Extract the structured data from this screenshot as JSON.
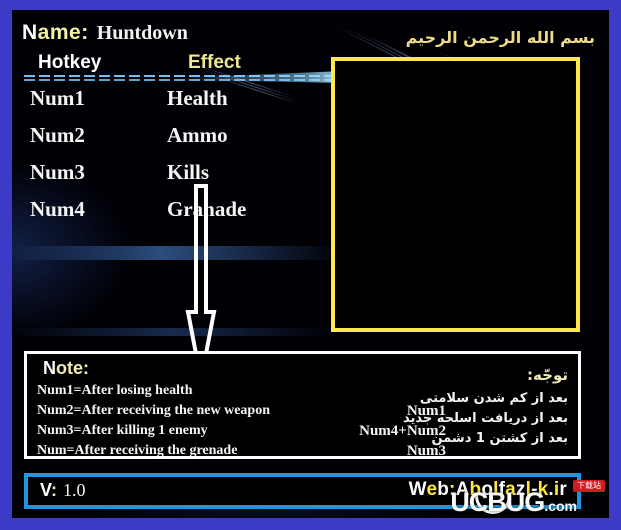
{
  "window": {
    "border_color": "#3b3bc8",
    "panel_bg": "#000005"
  },
  "header": {
    "name_label_first": "N",
    "name_label_rest": "ame:",
    "name_value": "Huntdown",
    "bismillah": "بسم الله الرحمن الرحيم",
    "columns": {
      "hotkey": "Hotkey",
      "effect": "Effect"
    }
  },
  "hotkeys": [
    {
      "key": "Num1",
      "effect": "Health"
    },
    {
      "key": "Num2",
      "effect": "Ammo"
    },
    {
      "key": "Num3",
      "effect": "Kills"
    },
    {
      "key": "Num4",
      "effect": "Granade"
    }
  ],
  "preview": {
    "border_color": "#ffe94a"
  },
  "note": {
    "title_first": "N",
    "title_rest": "ote:",
    "title_fa": "توجّه:",
    "lines_en": [
      "Num1=After losing health",
      "Num2=After receiving the new weapon",
      "Num3=After killing 1 enemy",
      "Num=After receiving the grenade"
    ],
    "lines_keys": [
      "Num1",
      "Num4+Num2",
      "Num3"
    ],
    "lines_fa": [
      "بعد از كم شدن سلامتى",
      "بعد از دريافت اسلحه جديد",
      "بعد از كشتن 1 دشمن"
    ]
  },
  "footer": {
    "version_label_first": "V",
    "version_label_rest": ":",
    "version_value": "1.0",
    "web_chars": [
      {
        "t": "W",
        "c": "w"
      },
      {
        "t": "e",
        "c": "y"
      },
      {
        "t": "b",
        "c": "w"
      },
      {
        "t": ":",
        "c": "y"
      },
      {
        "t": "A",
        "c": "w"
      },
      {
        "t": "b",
        "c": "y"
      },
      {
        "t": "o",
        "c": "w"
      },
      {
        "t": "l",
        "c": "y"
      },
      {
        "t": "f",
        "c": "w"
      },
      {
        "t": "a",
        "c": "y"
      },
      {
        "t": "z",
        "c": "w"
      },
      {
        "t": "l",
        "c": "y"
      },
      {
        "t": "-",
        "c": "w"
      },
      {
        "t": "k",
        "c": "y"
      },
      {
        "t": ".",
        "c": "w"
      },
      {
        "t": "i",
        "c": "y"
      },
      {
        "t": "r",
        "c": "w"
      }
    ],
    "web_text": "Web:Abolfazl-k.ir",
    "border_color": "#2196dd"
  },
  "watermark": {
    "text_main": "UCBUG",
    "text_suffix": ".com",
    "badge": "下载站"
  }
}
